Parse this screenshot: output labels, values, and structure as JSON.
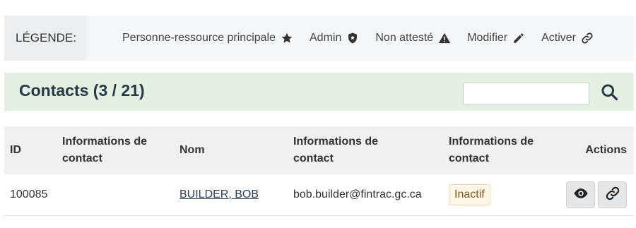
{
  "legend": {
    "title": "LÉGENDE:",
    "items": [
      {
        "label": "Personne-ressource principale",
        "icon": "star-icon"
      },
      {
        "label": "Admin",
        "icon": "shield-icon"
      },
      {
        "label": "Non attesté",
        "icon": "warning-icon"
      },
      {
        "label": "Modifier",
        "icon": "pencil-icon"
      },
      {
        "label": "Activer",
        "icon": "link-icon"
      }
    ]
  },
  "contacts": {
    "title": "Contacts (3 / 21)",
    "search_value": "",
    "search_icon": "search-icon"
  },
  "table": {
    "headers": {
      "id": "ID",
      "info1_line1": "Informations de",
      "info1_line2": "contact",
      "name": "Nom",
      "info2_line1": "Informations de",
      "info2_line2": "contact",
      "info3_line1": "Informations de",
      "info3_line2": "contact",
      "actions": "Actions"
    },
    "rows": [
      {
        "id": "100085",
        "info1": "",
        "name": "BUILDER, BOB",
        "email": "bob.builder@fintrac.gc.ca",
        "status": "Inactif",
        "actions": [
          "eye-icon",
          "link-icon"
        ]
      }
    ]
  },
  "colors": {
    "legend_bg": "#f5f6f7",
    "contacts_bar_bg": "#e4f1e1",
    "title_color": "#26374a",
    "link_color": "#284162",
    "badge_bg": "#fff6e6"
  }
}
